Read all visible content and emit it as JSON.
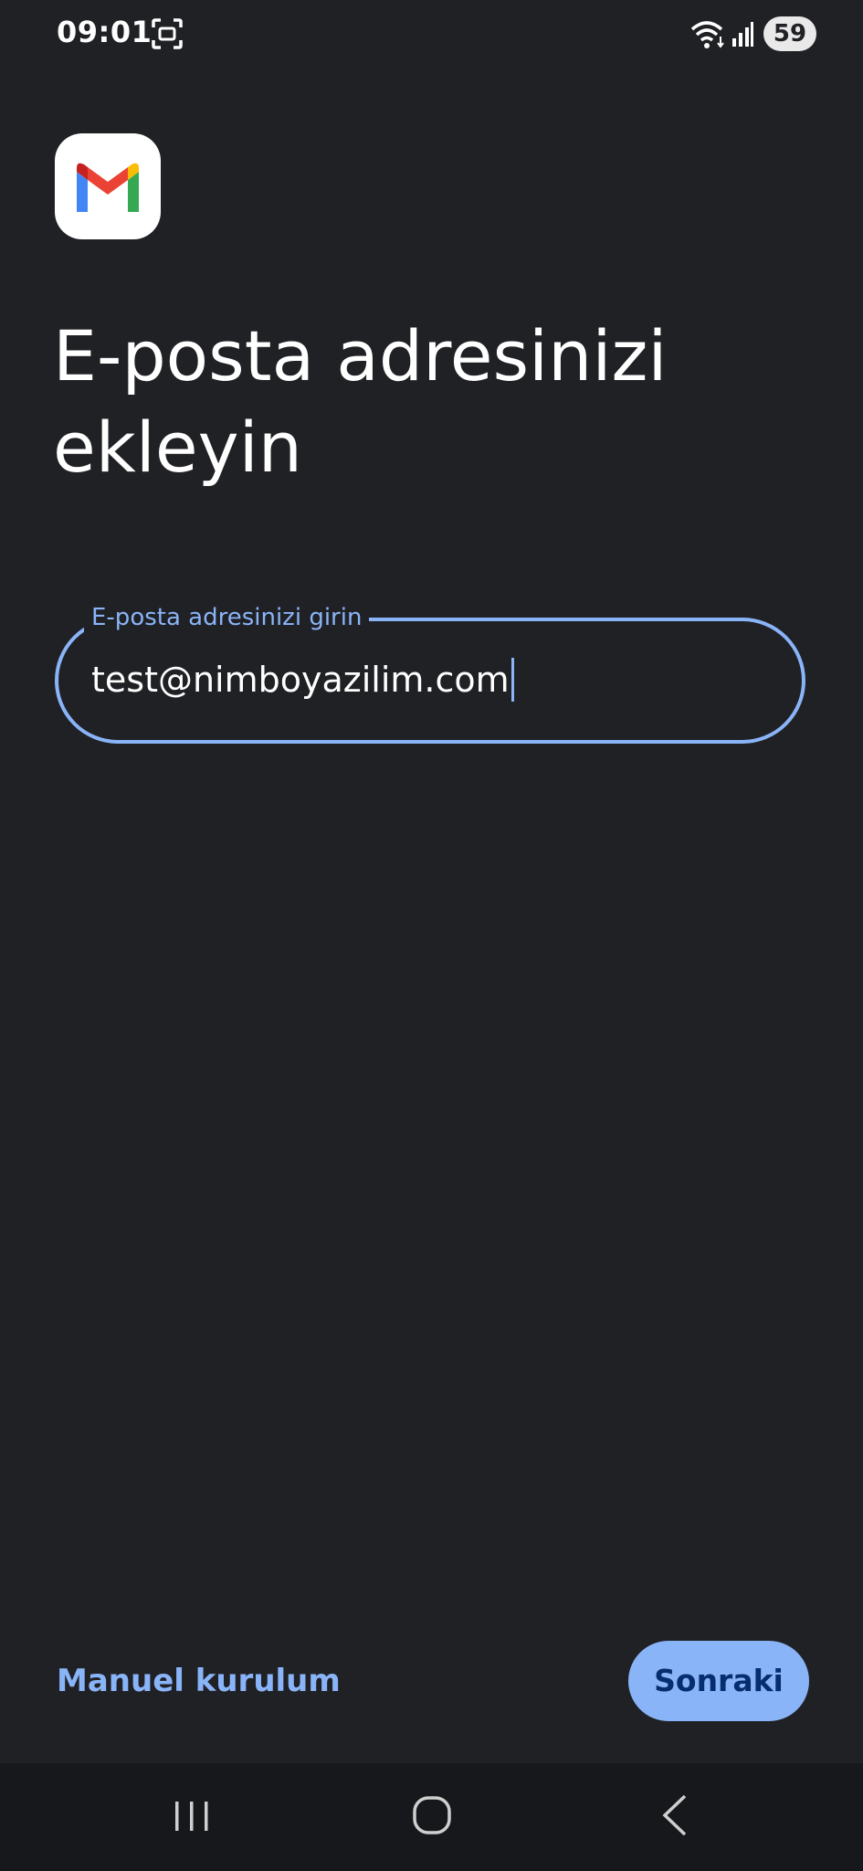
{
  "status_bar": {
    "time": "09:01",
    "battery_level": "59",
    "icons": [
      "screen-capture-icon",
      "wifi-icon",
      "signal-icon"
    ]
  },
  "app": {
    "logo_icon": "gmail-logo-icon",
    "title": "E-posta adresinizi ekleyin"
  },
  "email_field": {
    "label": "E-posta adresinizi girin",
    "value": "test@nimboyazilim.com"
  },
  "footer": {
    "manual_setup_label": "Manuel kurulum",
    "next_label": "Sonraki"
  },
  "nav_bar": {
    "icons": [
      "recents-icon",
      "home-icon",
      "back-icon"
    ]
  },
  "colors": {
    "background": "#202125",
    "accent": "#8ab4f8",
    "button_text": "#062e6f",
    "nav_background": "#17181b"
  }
}
